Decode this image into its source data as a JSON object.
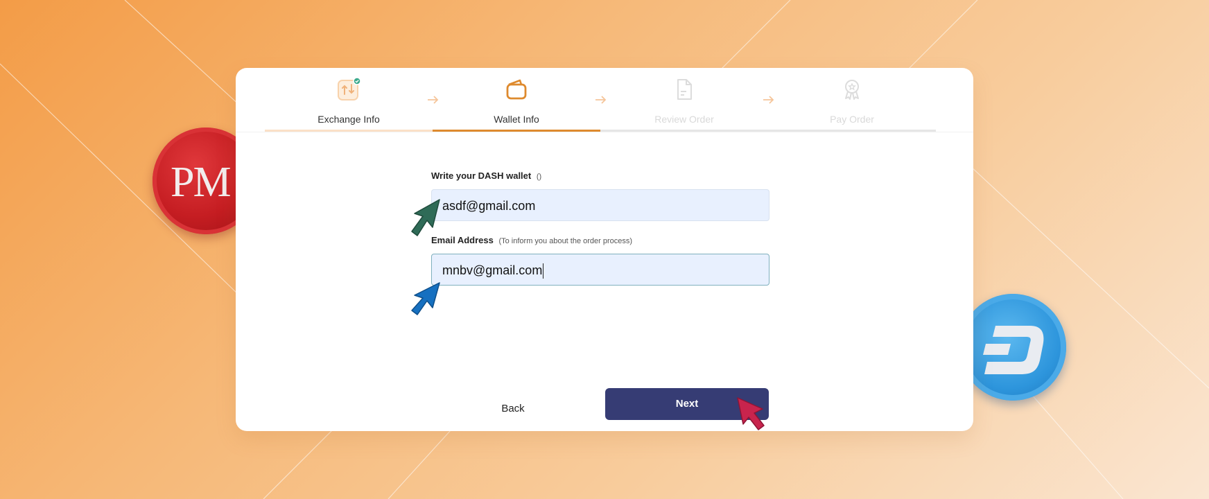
{
  "steps": [
    {
      "label": "Exchange Info",
      "status": "done"
    },
    {
      "label": "Wallet Info",
      "status": "active"
    },
    {
      "label": "Review Order",
      "status": "pending"
    },
    {
      "label": "Pay Order",
      "status": "pending"
    }
  ],
  "form": {
    "wallet_label": "Write your DASH wallet",
    "wallet_hint": "()",
    "wallet_value": "asdf@gmail.com",
    "email_label": "Email Address",
    "email_hint": "(To inform you about the order process)",
    "email_value": "mnbv@gmail.com"
  },
  "actions": {
    "back_label": "Back",
    "next_label": "Next"
  },
  "coins": {
    "left_coin_text": "PM",
    "right_coin_icon": "dash-logo-icon"
  },
  "colors": {
    "accent": "#de8a2e",
    "primary_button": "#363c74",
    "input_bg": "#e8f0fe"
  }
}
